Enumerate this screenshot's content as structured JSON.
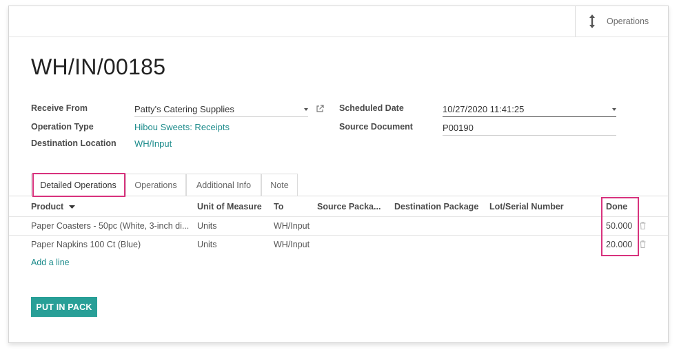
{
  "smart_button": {
    "label": "Operations",
    "icon": "vertical-arrows-icon"
  },
  "record": {
    "title": "WH/IN/00185"
  },
  "fields_left": [
    {
      "label": "Receive From",
      "value": "Patty's Catering Supplies"
    },
    {
      "label": "Operation Type",
      "value": "Hibou Sweets: Receipts"
    },
    {
      "label": "Destination Location",
      "value": "WH/Input"
    }
  ],
  "fields_right": [
    {
      "label": "Scheduled Date",
      "value": "10/27/2020 11:41:25"
    },
    {
      "label": "Source Document",
      "value": "P00190"
    }
  ],
  "tabs": [
    {
      "label": "Detailed Operations",
      "active": true
    },
    {
      "label": "Operations",
      "active": false
    },
    {
      "label": "Additional Info",
      "active": false
    },
    {
      "label": "Note",
      "active": false
    }
  ],
  "table": {
    "columns": [
      "Product",
      "Unit of Measure",
      "To",
      "Source Packa...",
      "Destination Package",
      "Lot/Serial Number",
      "Done"
    ],
    "rows": [
      {
        "product": "Paper Coasters - 50pc (White, 3-inch di...",
        "uom": "Units",
        "to": "WH/Input",
        "done": "50.000"
      },
      {
        "product": "Paper Napkins 100 Ct (Blue)",
        "uom": "Units",
        "to": "WH/Input",
        "done": "20.000"
      }
    ],
    "add_line": "Add a line"
  },
  "actions": {
    "put_in_pack": "PUT IN PACK"
  },
  "colors": {
    "accent": "#289f97",
    "link": "#1a8a8a",
    "highlight": "#d8327d"
  }
}
